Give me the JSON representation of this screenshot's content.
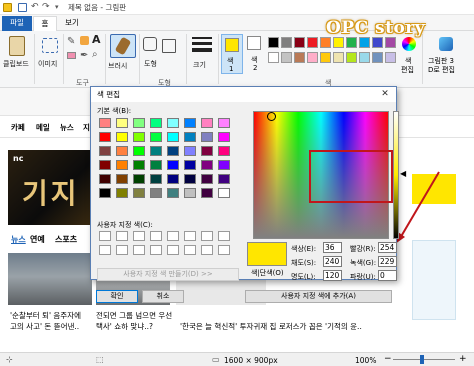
{
  "window": {
    "title": "제목 없음 - 그림판"
  },
  "tabs": {
    "file": "파일",
    "home": "홈",
    "view": "보기"
  },
  "ribbon": {
    "paste": "클립보드",
    "image": "이미지",
    "tools_group": "도구",
    "brush": "브러시",
    "shapes": "도형",
    "shapes_group": "도형",
    "size": "크기",
    "color1": "색\n1",
    "color1_num": "1",
    "color1_label": "색",
    "color2_label": "색",
    "color2_num": "2",
    "colors_group": "색",
    "edit_colors": "색\n편집",
    "edit_colors_a": "색",
    "edit_colors_b": "편집",
    "paint3d_a": "그림판 3",
    "paint3d_b": "D로 편집"
  },
  "annotation": {
    "text": "OPC story"
  },
  "dialog": {
    "title": "색 편집",
    "basic_colors_label": "기본 색(B):",
    "custom_colors_label": "사용자 지정 색(C):",
    "define_custom": "사용자 지정 색 만들기(D) >>",
    "ok": "확인",
    "cancel": "취소",
    "color_solid": "색|단색(O)",
    "add_custom": "사용자 지정 색에 추가(A)",
    "hue_label": "색상(E):",
    "hue": "36",
    "sat_label": "채도(S):",
    "sat": "240",
    "lum_label": "명도(L):",
    "lum": "120",
    "red_label": "빨강(R):",
    "red": "254",
    "green_label": "녹색(G):",
    "green": "229",
    "blue_label": "파랑(U):",
    "blue": "0"
  },
  "webpage": {
    "menu1": "카페",
    "menu2": "메일",
    "menu3": "뉴스",
    "menu4": "지도",
    "news_tab": "뉴스",
    "news_tab2": "연예",
    "news_tab3": "스포츠",
    "caption1": "'순찰부터 퇴' 음주자에",
    "caption1b": "고의 사고' 돈 뜯어낸..",
    "caption2": "전되면 그룹 넘으면 우선",
    "caption2b": "택사' 쇼하 맞냐..?",
    "caption3": "'한국은 늘 혁신적' 투자귀재 집 로저스가 꼽은 '기적의 윤..",
    "game_logo": "nc",
    "game_title": "기지"
  },
  "status": {
    "size": "1600 × 900px",
    "zoom": "100%"
  },
  "colors": {
    "accent": "#1e63b6",
    "selected": "#ffe600",
    "red_box": "#c0161b"
  },
  "basic_colors": [
    "#ff8080",
    "#ffff80",
    "#80ff80",
    "#00ff80",
    "#80ffff",
    "#0080ff",
    "#ff80c0",
    "#ff80ff",
    "#ff0000",
    "#ffff00",
    "#80ff00",
    "#00ff40",
    "#00ffff",
    "#0080c0",
    "#8080c0",
    "#ff00ff",
    "#804040",
    "#ff8040",
    "#00ff00",
    "#008080",
    "#004080",
    "#8080ff",
    "#800040",
    "#ff0080",
    "#800000",
    "#ff8000",
    "#008000",
    "#008040",
    "#0000ff",
    "#0000a0",
    "#800080",
    "#8000ff",
    "#400000",
    "#804000",
    "#004000",
    "#004040",
    "#000080",
    "#000040",
    "#400040",
    "#400080",
    "#000000",
    "#808000",
    "#808040",
    "#808080",
    "#408080",
    "#c0c0c0",
    "#400040",
    "#ffffff"
  ],
  "palette_top": [
    "#000000",
    "#7f7f7f",
    "#880015",
    "#ed1c24",
    "#ff7f27",
    "#fff200",
    "#22b14c",
    "#00a2e8",
    "#3f48cc",
    "#a349a4"
  ],
  "palette_bot": [
    "#ffffff",
    "#c3c3c3",
    "#b97a57",
    "#ffaec9",
    "#ffc90e",
    "#efe4b0",
    "#b5e61d",
    "#99d9ea",
    "#7092be",
    "#c8bfe7"
  ]
}
